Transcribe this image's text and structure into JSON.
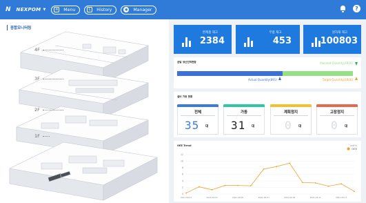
{
  "header": {
    "logo_mark": "N",
    "logo_text": "NEXPOM",
    "nav": [
      {
        "label": "Menu",
        "icon": "menu-icon"
      },
      {
        "label": "History",
        "icon": "history-icon"
      },
      {
        "label": "Manager",
        "icon": "gear-icon"
      }
    ],
    "help_glyph": "?"
  },
  "monitor": {
    "title": "종합모니터링",
    "floors": [
      "4F",
      "3F",
      "2F",
      "1F"
    ]
  },
  "kpis": [
    {
      "label": "완제품 재고",
      "value": "2384"
    },
    {
      "label": "부품 재고",
      "value": "453"
    },
    {
      "label": "원자재 재고",
      "value": "100803"
    }
  ],
  "production": {
    "title": "금일 생산진척현황",
    "actual_label": "Actual Quantity(891)",
    "target_label": "Target Quantity(1000)",
    "planned_label": "Planned Quantity(1000)",
    "actual_fraction": 0.6
  },
  "equipment": {
    "title": "설비 가동 현황",
    "unit": "대",
    "items": [
      {
        "label": "전체",
        "value": "35",
        "color": "#3a7be0",
        "digit_color": "#3a7be0"
      },
      {
        "label": "가동",
        "value": "31",
        "color": "#2cc7a3",
        "digit_color": "#222222"
      },
      {
        "label": "계획정지",
        "value": "0",
        "color": "#f2c22e",
        "digit_color": "#d9dde3"
      },
      {
        "label": "고장정지",
        "value": "0",
        "color": "#e8684a",
        "digit_color": "#d9dde3"
      }
    ]
  },
  "chart_data": {
    "type": "line",
    "title": "OEE Trend",
    "unit_label": "unit:%",
    "series": [
      {
        "name": "OEE",
        "color": "#f0a029",
        "values": [
          0.3,
          2.2,
          1.3,
          2.6,
          2.6,
          2.5,
          7.6,
          8.4,
          9.4,
          3.5,
          3.4,
          2.4,
          3.1,
          0.8
        ]
      }
    ],
    "x": [
      "2021-09-01",
      "2021-09-02",
      "2021-09-03",
      "2021-09-04",
      "2021-09-05",
      "2021-09-06",
      "2021-09-07",
      "2021-09-08",
      "2021-09-09",
      "2021-09-10",
      "2021-09-11",
      "2021-09-12",
      "2021-09-13",
      "2021-09-14"
    ],
    "x_ticks": [
      "2021-09-01",
      "2021-09-03",
      "2021-09-05",
      "2021-09-07",
      "2021-09-09",
      "2021-09-11",
      "2021-09-13"
    ],
    "yticks": [
      0,
      2,
      4,
      6,
      8,
      10,
      12
    ],
    "ylim": [
      0,
      12
    ],
    "grid": true,
    "legend": "top-right"
  }
}
